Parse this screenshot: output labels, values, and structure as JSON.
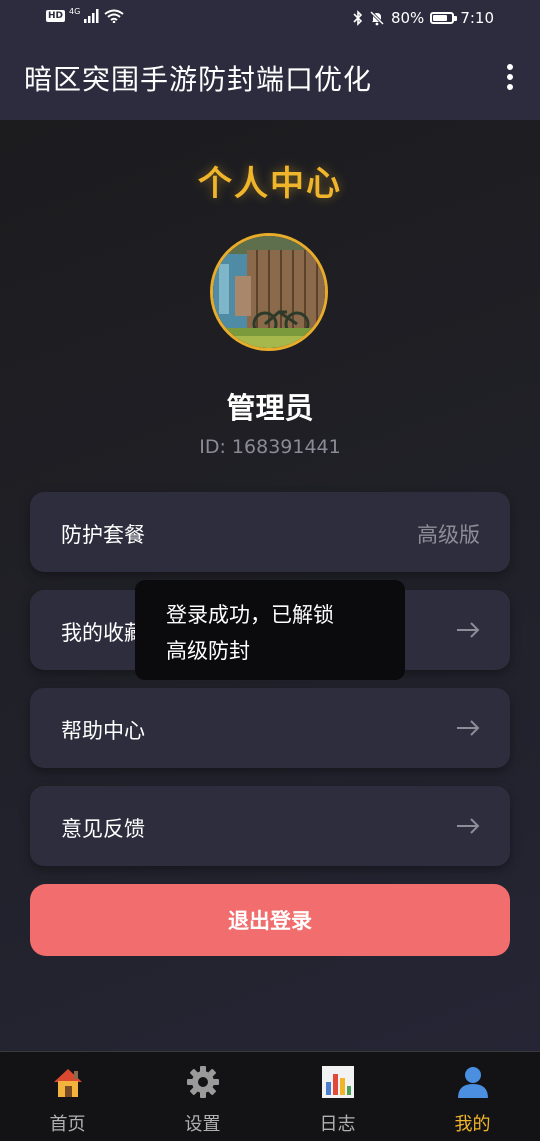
{
  "status_bar": {
    "network_badge": "HD",
    "network_type": "4G",
    "battery": "80%",
    "battery_level": 0.8,
    "time": "7:10"
  },
  "app_bar": {
    "title": "暗区突围手游防封端口优化",
    "menu_icon": "more-vertical-icon"
  },
  "profile": {
    "page_title": "个人中心",
    "name": "管理员",
    "id": "ID: 168391441",
    "accent_color": "#f0b52a"
  },
  "menu": [
    {
      "label": "防护套餐",
      "value": "高级版"
    },
    {
      "label": "我的收藏",
      "icon": "arrow-right-icon"
    },
    {
      "label": "帮助中心",
      "icon": "arrow-right-icon"
    },
    {
      "label": "意见反馈",
      "icon": "arrow-right-icon"
    }
  ],
  "logout": {
    "label": "退出登录",
    "color": "#f26d6d"
  },
  "toast": {
    "line1": "登录成功，已解锁",
    "line2": "高级防封"
  },
  "bottom_nav": [
    {
      "label": "首页",
      "icon": "house-icon",
      "active": false
    },
    {
      "label": "设置",
      "icon": "gear-icon",
      "active": false
    },
    {
      "label": "日志",
      "icon": "bar-chart-icon",
      "active": false
    },
    {
      "label": "我的",
      "icon": "person-icon",
      "active": true
    }
  ]
}
